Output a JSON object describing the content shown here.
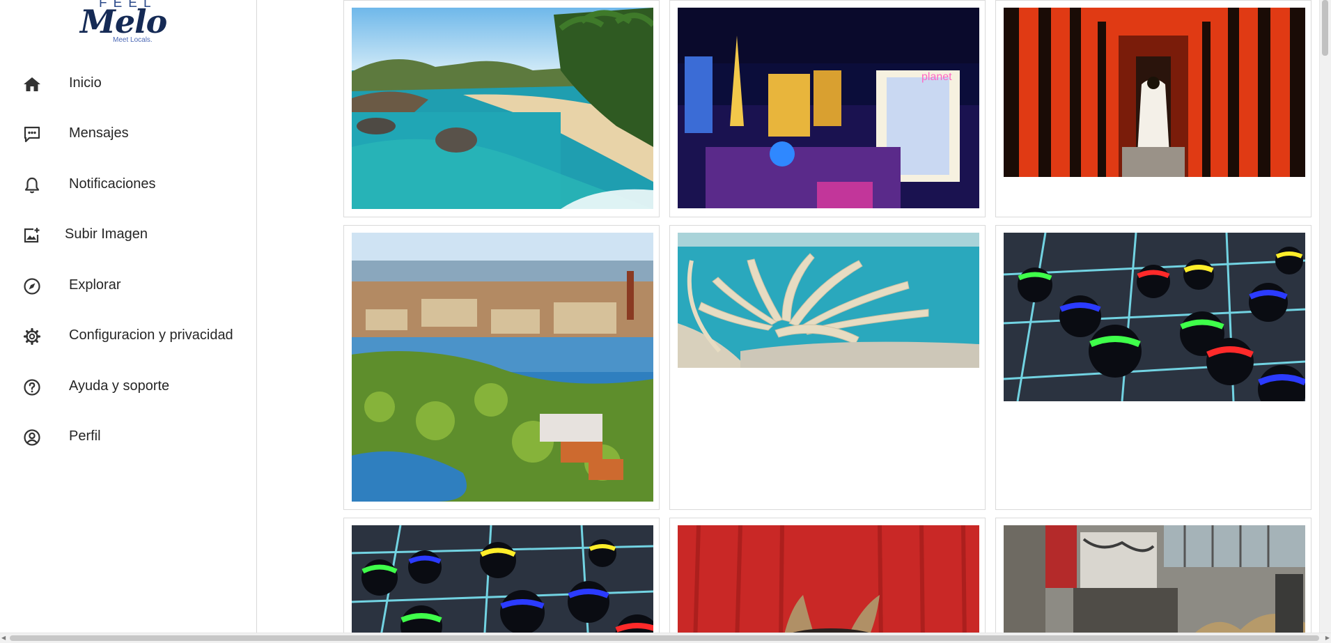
{
  "brand": {
    "top": "FEEL",
    "name": "Melo",
    "tagline": "Meet Locals."
  },
  "nav": [
    {
      "label": "Inicio",
      "icon": "home-icon"
    },
    {
      "label": "Mensajes",
      "icon": "message-icon"
    },
    {
      "label": "Notificaciones",
      "icon": "bell-icon"
    },
    {
      "label": "Subir Imagen",
      "icon": "add-image-icon"
    },
    {
      "label": "Explorar",
      "icon": "compass-icon"
    },
    {
      "label": "Configuracion y privacidad",
      "icon": "gear-icon"
    },
    {
      "label": "Ayuda y soporte",
      "icon": "help-icon"
    },
    {
      "label": "Perfil",
      "icon": "profile-icon"
    }
  ],
  "gallery": {
    "images": [
      {
        "subject": "tropical beach with palm trees"
      },
      {
        "subject": "las vegas strip at night",
        "sign": "planet"
      },
      {
        "subject": "red torii gate corridor"
      },
      {
        "subject": "stockholm city aerial view"
      },
      {
        "subject": "palm island aerial view"
      },
      {
        "subject": "neon glass spheres on grid"
      },
      {
        "subject": "neon glass spheres on grid"
      },
      {
        "subject": "red curtain with animal ears"
      },
      {
        "subject": "abandoned building with graffiti"
      }
    ]
  },
  "colors": {
    "icon": "#333333",
    "text": "#262626",
    "border": "#dadada",
    "brand": "#152a55"
  }
}
